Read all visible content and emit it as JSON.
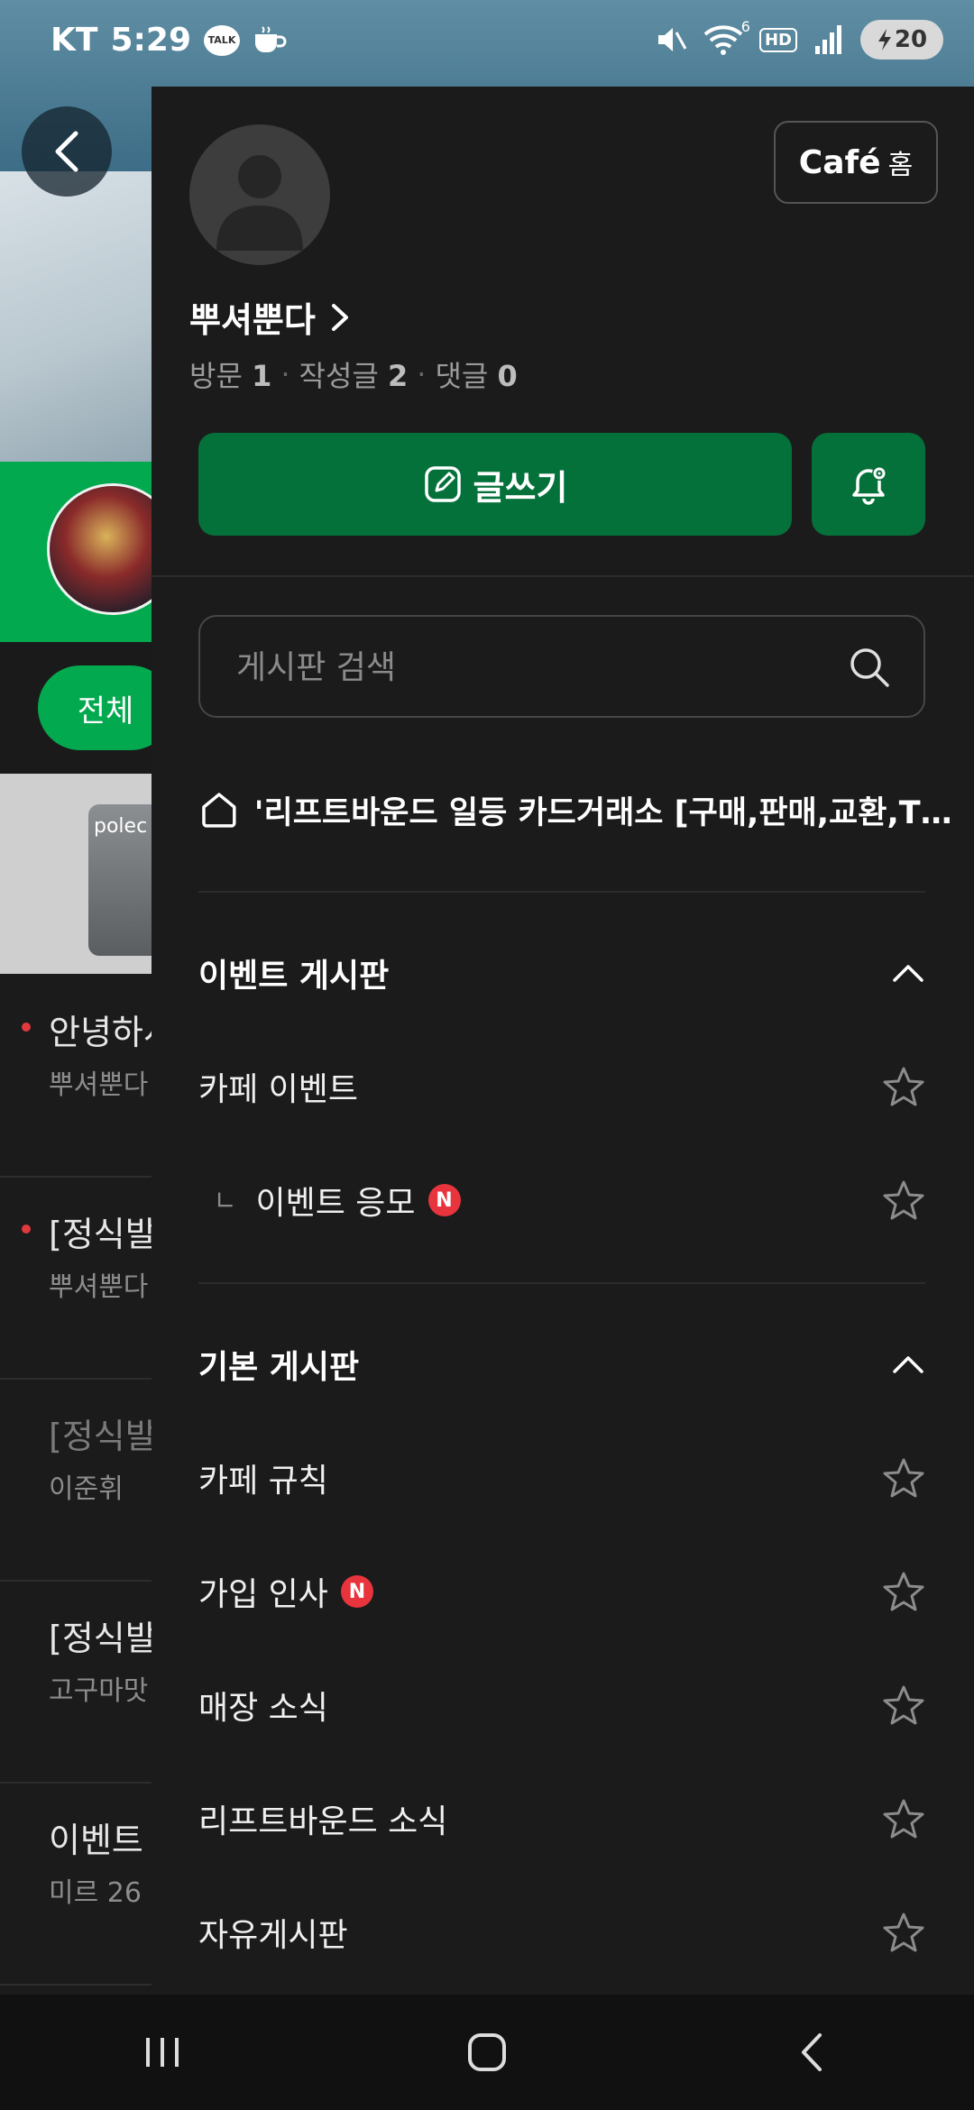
{
  "status_bar": {
    "carrier": "KT",
    "time": "5:29",
    "talk_label": "TALK",
    "hd_label": "HD",
    "wifi_badge": "6",
    "battery": "20"
  },
  "background_page": {
    "tab_all": "전체",
    "banner_brand": "polec",
    "items": [
      {
        "title": "안녕하시",
        "sub": "뿌셔뿐다",
        "dot": true,
        "dim": false
      },
      {
        "title": "[정식발",
        "sub": "뿌셔뿐다",
        "dot": true,
        "dim": false
      },
      {
        "title": "[정식발",
        "sub": "이준휘",
        "dot": false,
        "dim": true
      },
      {
        "title": "[정식발",
        "sub": "고구마맛",
        "dot": false,
        "dim": false
      },
      {
        "title": "이벤트",
        "sub": "미르  26",
        "dot": false,
        "dim": false
      }
    ]
  },
  "drawer": {
    "cafe_home": {
      "cafe": "Café",
      "home": "홈"
    },
    "profile": {
      "nickname": "뿌셔뿐다",
      "stats": [
        {
          "label": "방문",
          "value": "1"
        },
        {
          "label": "작성글",
          "value": "2"
        },
        {
          "label": "댓글",
          "value": "0"
        }
      ]
    },
    "write_label": "글쓰기",
    "search_placeholder": "게시판 검색",
    "cafe_name": "'리프트바운드 일등 카드거래소 [구매,판매,교환,TC...",
    "sections": [
      {
        "title": "이벤트 게시판",
        "boards": [
          {
            "label": "카페 이벤트",
            "sub": false,
            "new": false
          },
          {
            "label": "이벤트 응모",
            "sub": true,
            "new": true
          }
        ]
      },
      {
        "title": "기본 게시판",
        "boards": [
          {
            "label": "카페 규칙",
            "sub": false,
            "new": false
          },
          {
            "label": "가입 인사",
            "sub": false,
            "new": true
          },
          {
            "label": "매장 소식",
            "sub": false,
            "new": false
          },
          {
            "label": "리프트바운드 소식",
            "sub": false,
            "new": false
          },
          {
            "label": "자유게시판",
            "sub": false,
            "new": false
          }
        ]
      }
    ],
    "new_badge": "N"
  },
  "colors": {
    "accent_green": "#05713a",
    "cafe_green": "#03a94e",
    "new_badge": "#e8343d",
    "drawer_bg": "#1b1b1b"
  },
  "icons": {
    "back": "chevron-left-icon",
    "write": "edit-icon",
    "alarm": "bell-settings-icon",
    "search": "search-icon",
    "home": "house-icon",
    "collapse": "chevron-up-icon",
    "favorite": "star-outline-icon"
  }
}
